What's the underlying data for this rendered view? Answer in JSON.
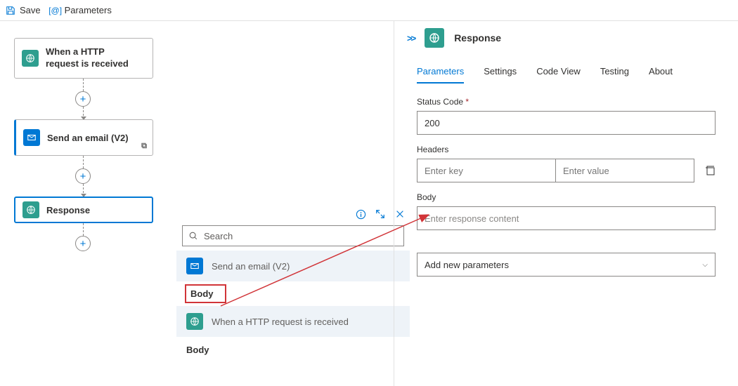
{
  "toolbar": {
    "save": "Save",
    "parameters": "Parameters"
  },
  "workflow": {
    "http_node": "When a HTTP request is received",
    "email_node": "Send an email (V2)",
    "response_node": "Response"
  },
  "popup": {
    "search_placeholder": "Search",
    "items": [
      {
        "label": "Send an email (V2)",
        "icon": "blue"
      },
      {
        "label": "When a HTTP request is received",
        "icon": "teal"
      }
    ],
    "body_label1": "Body",
    "body_label2": "Body"
  },
  "panel": {
    "title": "Response",
    "tabs": {
      "parameters": "Parameters",
      "settings": "Settings",
      "codeview": "Code View",
      "testing": "Testing",
      "about": "About"
    },
    "status_code_label": "Status Code",
    "status_code_value": "200",
    "headers_label": "Headers",
    "headers_key_placeholder": "Enter key",
    "headers_value_placeholder": "Enter value",
    "body_label": "Body",
    "body_placeholder": "Enter response content",
    "add_params": "Add new parameters"
  }
}
